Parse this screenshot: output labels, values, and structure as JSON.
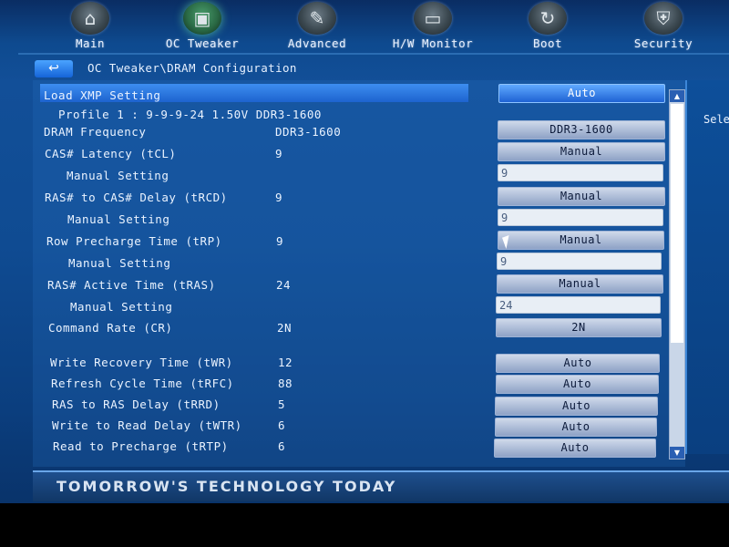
{
  "nav": [
    {
      "label": "Main",
      "icon": "home-icon",
      "glyph": "⌂"
    },
    {
      "label": "OC Tweaker",
      "icon": "cpu-icon",
      "glyph": "▣"
    },
    {
      "label": "Advanced",
      "icon": "wrench-icon",
      "glyph": "✎"
    },
    {
      "label": "H/W Monitor",
      "icon": "monitor-icon",
      "glyph": "▭"
    },
    {
      "label": "Boot",
      "icon": "refresh-icon",
      "glyph": "↻"
    },
    {
      "label": "Security",
      "icon": "shield-icon",
      "glyph": "⛨"
    }
  ],
  "breadcrumb": "OC Tweaker\\DRAM Configuration",
  "back_icon": "↩",
  "rows": [
    {
      "label": "Load XMP Setting",
      "value": "",
      "control": "Auto",
      "type": "button",
      "selected": true
    },
    {
      "label": "Profile 1 : 9-9-9-24 1.50V DDR3-1600",
      "value": "",
      "control": "",
      "type": "none"
    },
    {
      "label": "DRAM Frequency",
      "value": "DDR3-1600",
      "control": "DDR3-1600",
      "type": "button"
    },
    {
      "label": "CAS# Latency (tCL)",
      "value": "9",
      "control": "Manual",
      "type": "button"
    },
    {
      "label": "Manual Setting",
      "value": "",
      "control": "9",
      "type": "input"
    },
    {
      "label": "RAS# to CAS# Delay (tRCD)",
      "value": "9",
      "control": "Manual",
      "type": "button"
    },
    {
      "label": "Manual Setting",
      "value": "",
      "control": "9",
      "type": "input"
    },
    {
      "label": "Row Precharge Time (tRP)",
      "value": "9",
      "control": "Manual",
      "type": "button"
    },
    {
      "label": "Manual Setting",
      "value": "",
      "control": "9",
      "type": "input"
    },
    {
      "label": "RAS# Active Time (tRAS)",
      "value": "24",
      "control": "Manual",
      "type": "button"
    },
    {
      "label": "Manual Setting",
      "value": "",
      "control": "24",
      "type": "input"
    },
    {
      "label": "Command Rate (CR)",
      "value": "2N",
      "control": "2N",
      "type": "button"
    },
    {
      "label": "Write Recovery Time (tWR)",
      "value": "12",
      "control": "Auto",
      "type": "button"
    },
    {
      "label": "Refresh Cycle Time (tRFC)",
      "value": "88",
      "control": "Auto",
      "type": "button"
    },
    {
      "label": "RAS to RAS Delay (tRRD)",
      "value": "5",
      "control": "Auto",
      "type": "button"
    },
    {
      "label": "Write to Read Delay (tWTR)",
      "value": "6",
      "control": "Auto",
      "type": "button"
    },
    {
      "label": "Read to Precharge (tRTP)",
      "value": "6",
      "control": "Auto",
      "type": "button"
    }
  ],
  "help_text": "Sele",
  "footer": "TOMORROW'S TECHNOLOGY TODAY",
  "scroll_up": "▲",
  "scroll_down": "▼"
}
